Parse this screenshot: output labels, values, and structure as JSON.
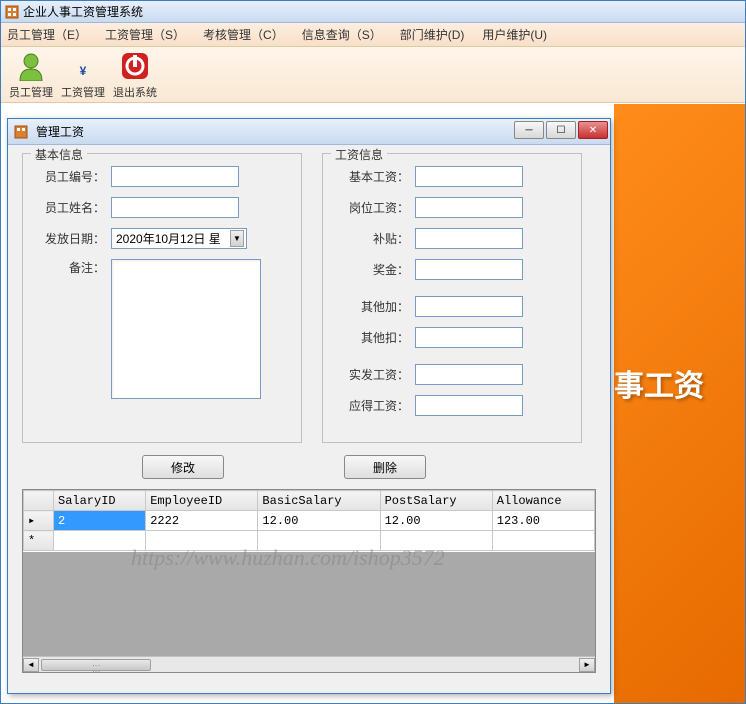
{
  "main_window": {
    "title": "企业人事工资管理系统"
  },
  "menu": {
    "items": [
      "员工管理（E）",
      "工资管理（S）",
      "考核管理（C）",
      "信息查询（S）",
      "部门维护(D)",
      "用户维护(U)"
    ]
  },
  "toolbar": {
    "items": [
      {
        "name": "employee-mgmt",
        "label": "员工管理"
      },
      {
        "name": "salary-mgmt",
        "label": "工资管理"
      },
      {
        "name": "exit-system",
        "label": "退出系统"
      }
    ]
  },
  "dialog": {
    "title": "管理工资",
    "group_basic": {
      "legend": "基本信息",
      "emp_id_label": "员工编号：",
      "emp_id_value": "",
      "emp_name_label": "员工姓名：",
      "emp_name_value": "",
      "pay_date_label": "发放日期：",
      "pay_date_value": "2020年10月12日 星",
      "remark_label": "备注：",
      "remark_value": ""
    },
    "group_salary": {
      "legend": "工资信息",
      "basic_label": "基本工资：",
      "basic_value": "",
      "post_label": "岗位工资：",
      "post_value": "",
      "allowance_label": "补贴：",
      "allowance_value": "",
      "bonus_label": "奖金：",
      "bonus_value": "",
      "other_add_label": "其他加：",
      "other_add_value": "",
      "other_sub_label": "其他扣：",
      "other_sub_value": "",
      "actual_label": "实发工资：",
      "actual_value": "",
      "due_label": "应得工资：",
      "due_value": ""
    },
    "buttons": {
      "modify": "修改",
      "delete": "删除"
    },
    "grid": {
      "columns": [
        "SalaryID",
        "EmployeeID",
        "BasicSalary",
        "PostSalary",
        "Allowance"
      ],
      "rows": [
        {
          "SalaryID": "2",
          "EmployeeID": "2222",
          "BasicSalary": "12.00",
          "PostSalary": "12.00",
          "Allowance": "123.00"
        }
      ]
    }
  },
  "bg_text": "事工资",
  "watermark": "https://www.huzhan.com/ishop3572"
}
